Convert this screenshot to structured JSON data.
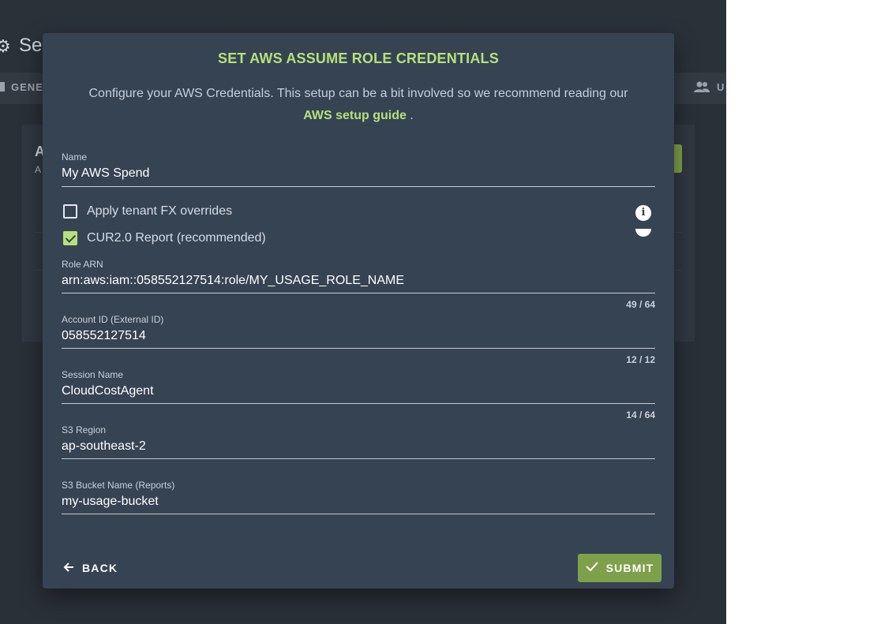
{
  "background": {
    "page_title": "Se",
    "tab_left_label": "GENE",
    "tab_right_label": "U",
    "card_title": "A",
    "card_subtitle": "A"
  },
  "dialog": {
    "title": "SET AWS ASSUME ROLE CREDENTIALS",
    "description": "Configure your AWS Credentials. This setup can be a bit involved so we recommend reading our",
    "link_text": "AWS setup guide",
    "link_suffix": ".",
    "fields": {
      "name": {
        "label": "Name",
        "value": "My AWS Spend"
      },
      "role_arn": {
        "label": "Role ARN",
        "value": "arn:aws:iam::058552127514:role/MY_USAGE_ROLE_NAME",
        "counter": "49 / 64"
      },
      "account_id": {
        "label": "Account ID (External ID)",
        "value": "058552127514",
        "counter": "12 / 12"
      },
      "session_name": {
        "label": "Session Name",
        "value": "CloudCostAgent",
        "counter": "14 / 64"
      },
      "s3_region": {
        "label": "S3 Region",
        "value": "ap-southeast-2"
      },
      "s3_bucket": {
        "label": "S3 Bucket Name (Reports)",
        "value": "my-usage-bucket"
      }
    },
    "checkboxes": {
      "fx_overrides": {
        "label": "Apply tenant FX overrides",
        "checked": false
      },
      "cur2": {
        "label": "CUR2.0 Report (recommended)",
        "checked": true
      }
    },
    "back_label": "BACK",
    "submit_label": "SUBMIT"
  },
  "colors": {
    "accent_green": "#b7e07a",
    "button_green": "#7fa04a",
    "dialog_bg": "#364353",
    "app_bg": "#2a3038"
  },
  "icons": {
    "settings": "gear-icon",
    "info": "info-icon",
    "back": "arrow-left-icon",
    "submit": "check-icon",
    "users": "people-icon"
  }
}
